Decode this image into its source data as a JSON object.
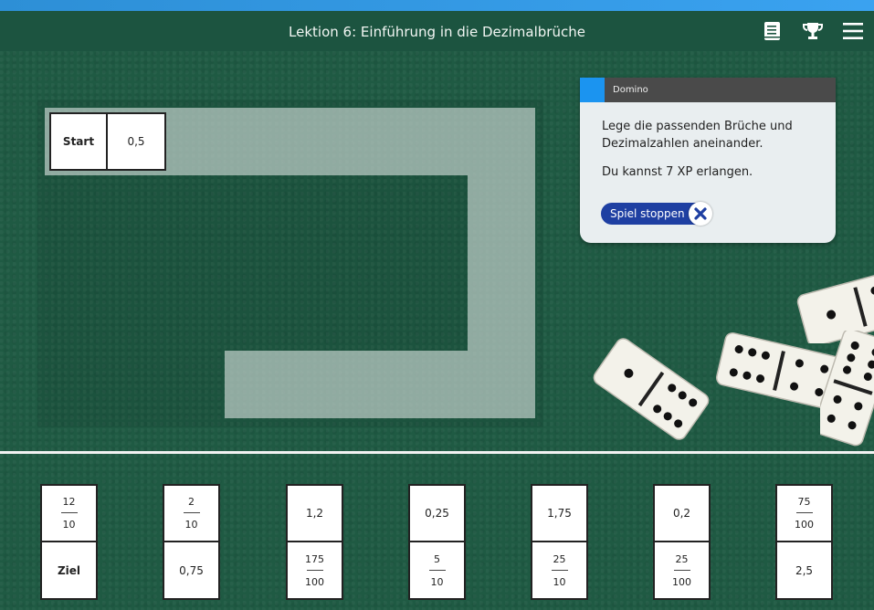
{
  "header": {
    "title": "Lektion 6: Einführung in die Dezimalbrüche",
    "icons": [
      "book-icon",
      "trophy-icon",
      "menu-icon"
    ]
  },
  "board": {
    "start_tile": {
      "left": "Start",
      "right": "0,5"
    }
  },
  "card": {
    "header_label": "Domino",
    "instruction": "Lege die passenden Brüche und Dezimalzahlen aneinander.",
    "xp_text": "Du kannst 7 XP erlangen.",
    "stop_button": "Spiel stoppen",
    "accent_color": "#1b94f0",
    "button_color": "#1e3fa2"
  },
  "tray": {
    "tiles": [
      {
        "top": {
          "num": "12",
          "den": "10"
        },
        "bottom": {
          "text": "Ziel"
        }
      },
      {
        "top": {
          "num": "2",
          "den": "10"
        },
        "bottom": {
          "text": "0,75"
        }
      },
      {
        "top": {
          "text": "1,2"
        },
        "bottom": {
          "num": "175",
          "den": "100"
        }
      },
      {
        "top": {
          "text": "0,25"
        },
        "bottom": {
          "num": "5",
          "den": "10"
        }
      },
      {
        "top": {
          "text": "1,75"
        },
        "bottom": {
          "num": "25",
          "den": "10"
        }
      },
      {
        "top": {
          "text": "0,2"
        },
        "bottom": {
          "num": "25",
          "den": "100"
        }
      },
      {
        "top": {
          "num": "75",
          "den": "100"
        },
        "bottom": {
          "text": "2,5"
        }
      }
    ]
  }
}
